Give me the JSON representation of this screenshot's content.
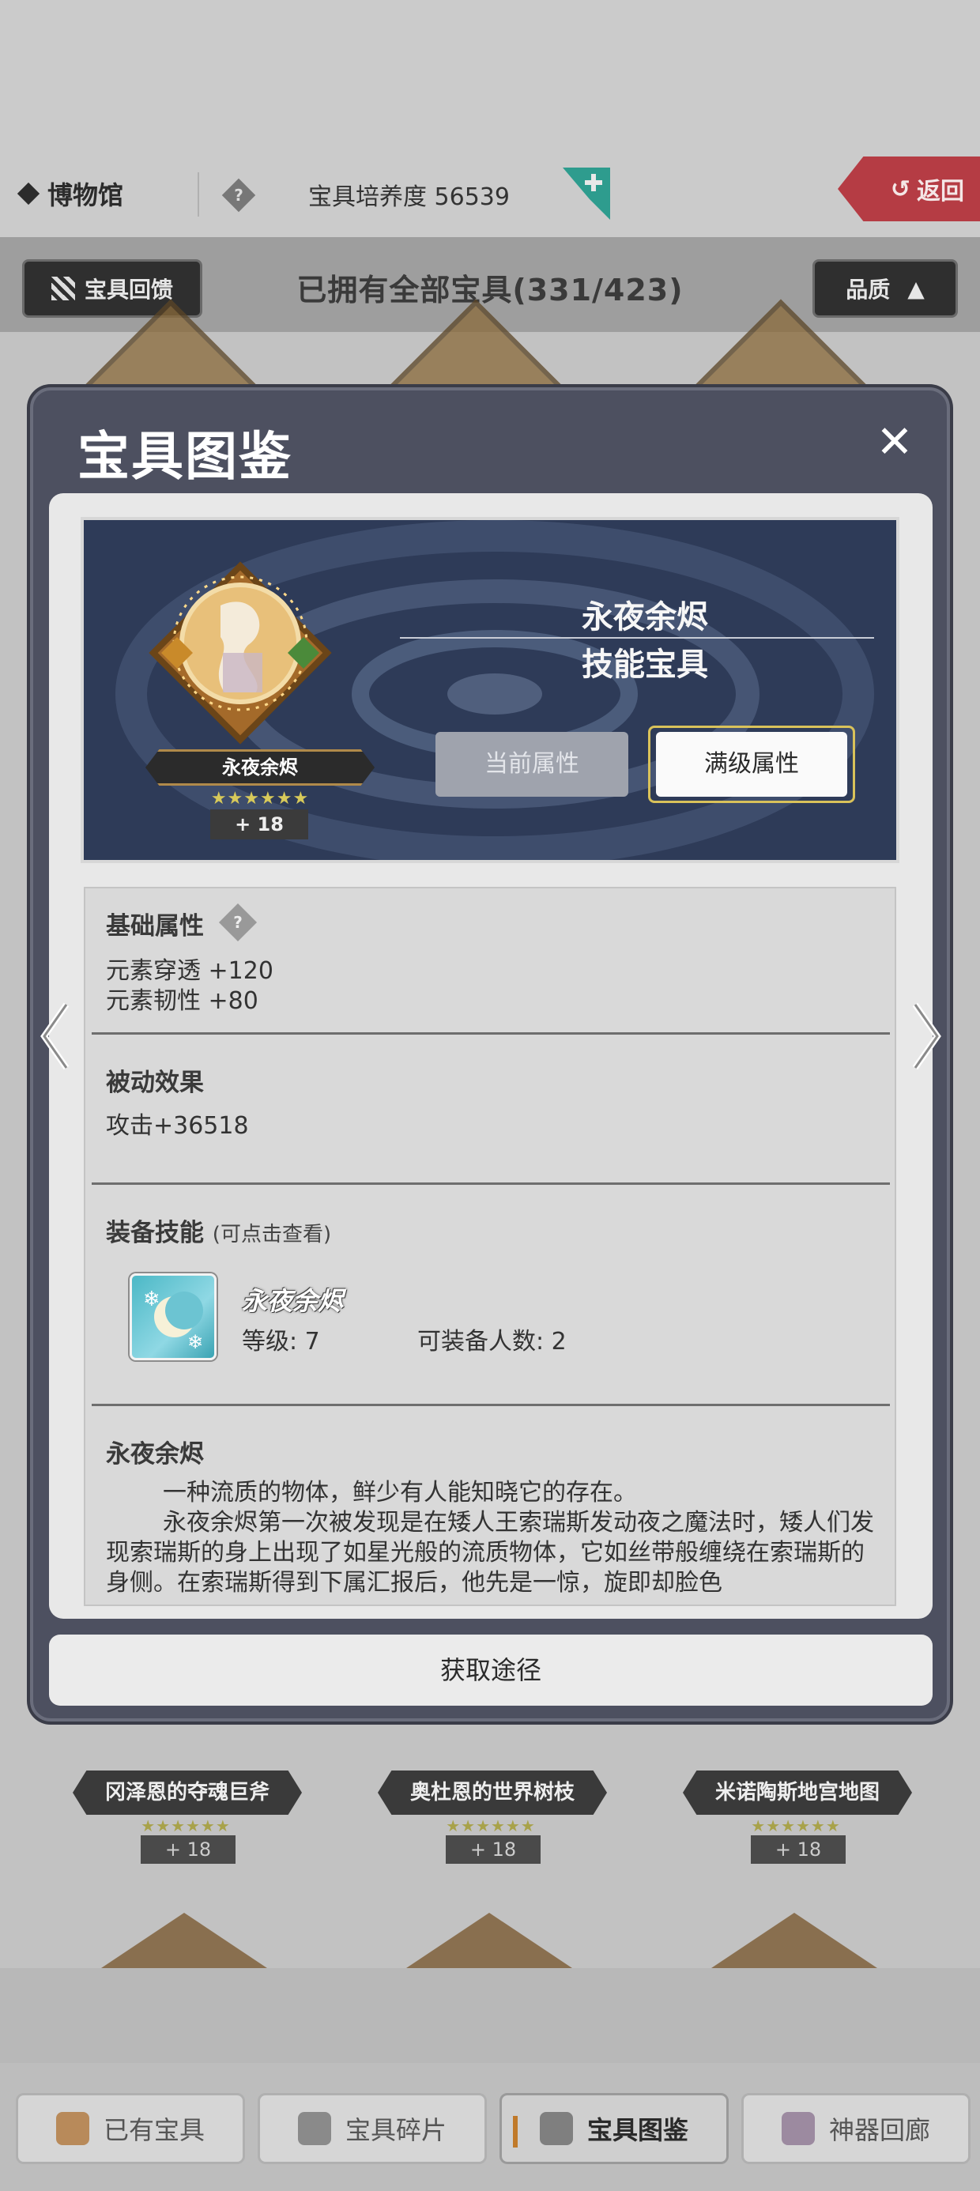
{
  "header": {
    "museum_label": "博物馆",
    "help_glyph": "?",
    "cultivation_label": "宝具培养度 56539",
    "return_label": "返回"
  },
  "toolbar": {
    "feedback_label": "宝具回馈",
    "owned_summary": "已拥有全部宝具(331/423)",
    "quality_label": "品质"
  },
  "background_cards": [
    {
      "name": "冈泽恩的夺魂巨斧",
      "plus": "+ 18"
    },
    {
      "name": "奥杜恩的世界树枝",
      "plus": "+ 18"
    },
    {
      "name": "米诺陶斯地宫地图",
      "plus": "+ 18"
    }
  ],
  "modal": {
    "title": "宝具图鉴",
    "close_glyph": "✕",
    "relic": {
      "name": "永夜余烬",
      "type": "技能宝具",
      "plate_name": "永夜余烬",
      "stars": "★★★★★★",
      "plus": "+ 18"
    },
    "tabs": {
      "current_label": "当前属性",
      "max_label": "满级属性"
    },
    "basic": {
      "title": "基础属性",
      "help_glyph": "?",
      "lines": [
        "元素穿透 +120",
        "元素韧性 +80"
      ]
    },
    "passive": {
      "title": "被动效果",
      "text": "攻击+36518"
    },
    "skill": {
      "title": "装备技能",
      "hint": "(可点击查看)",
      "name": "永夜余烬",
      "level": "等级: 7",
      "equip": "可装备人数: 2"
    },
    "lore": {
      "title": "永夜余烬",
      "paragraphs": [
        "一种流质的物体，鲜少有人能知晓它的存在。",
        "永夜余烬第一次被发现是在矮人王索瑞斯发动夜之魔法时，矮人们发现索瑞斯的身上出现了如星光般的流质物体，它如丝带般缠绕在索瑞斯的身侧。在索瑞斯得到下属汇报后，他先是一惊，旋即却脸色"
      ]
    },
    "acquire_label": "获取途径"
  },
  "bottom_tabs": [
    {
      "label": "已有宝具",
      "icon": "owned-relic-icon"
    },
    {
      "label": "宝具碎片",
      "icon": "fragment-icon"
    },
    {
      "label": "宝具图鉴",
      "icon": "codex-icon"
    },
    {
      "label": "神器回廊",
      "icon": "artifact-icon"
    }
  ],
  "colors": {
    "modal_bg": "#4d5060",
    "return_red": "#b53c44",
    "gold_border": "#d9c25a"
  }
}
